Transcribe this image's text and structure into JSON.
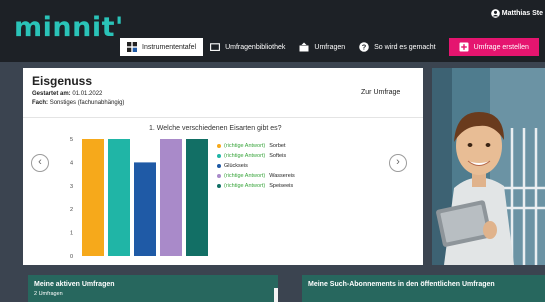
{
  "app": {
    "logo": "minnit'"
  },
  "user": {
    "name": "Matthias Ste"
  },
  "nav": [
    {
      "label": "Instrumententafel",
      "icon": "dashboard-icon",
      "active": true
    },
    {
      "label": "Umfragenbibliothek",
      "icon": "folder-icon",
      "active": false
    },
    {
      "label": "Umfragen",
      "icon": "survey-icon",
      "active": false
    },
    {
      "label": "So wird es gemacht",
      "icon": "help-icon",
      "active": false
    },
    {
      "label": "Umfrage erstellen",
      "icon": "plus-square-icon",
      "active": false
    }
  ],
  "survey": {
    "title": "Eisgenuss",
    "started_label": "Gestartet am:",
    "started_value": "01.01.2022",
    "subject_label": "Fach:",
    "subject_value": "Sonstiges (fachunabhängig)",
    "link_label": "Zur Umfrage",
    "question": "1. Welche verschiedenen Eisarten gibt es?",
    "nav_prev": "‹",
    "nav_next": "›"
  },
  "legend": [
    {
      "prefix": "(richtige Antwort)",
      "label": "Sorbet"
    },
    {
      "prefix": "(richtige Antwort)",
      "label": "Softeis"
    },
    {
      "prefix": "",
      "label": "Glückseis"
    },
    {
      "prefix": "(richtige Antwort)",
      "label": "Wassereis"
    },
    {
      "prefix": "(richtige Antwort)",
      "label": "Speiseeis"
    }
  ],
  "chart_data": {
    "type": "bar",
    "categories": [
      "Sorbet",
      "Softeis",
      "Glückseis",
      "Wassereis",
      "Speiseeis"
    ],
    "values": [
      5,
      5,
      4,
      5,
      5
    ],
    "colors": [
      "#f6a91b",
      "#20b5a6",
      "#1f5aa6",
      "#a98ac9",
      "#126f65"
    ],
    "yticks": [
      0,
      1,
      2,
      3,
      4,
      5
    ],
    "ylim": [
      0,
      5
    ],
    "title": "1. Welche verschiedenen Eisarten gibt es?",
    "grid": false,
    "legend_position": "right"
  },
  "panels": [
    {
      "title": "Meine aktiven Umfragen",
      "subtitle": "2 Umfragen"
    },
    {
      "title": "Meine Such-Abonnements in den öffentlichen Umfragen",
      "subtitle": ""
    }
  ],
  "colors": {
    "accent": "#2ac3b8",
    "cta": "#e5156f",
    "panel": "#27675e",
    "correct": "#3aa63d"
  }
}
